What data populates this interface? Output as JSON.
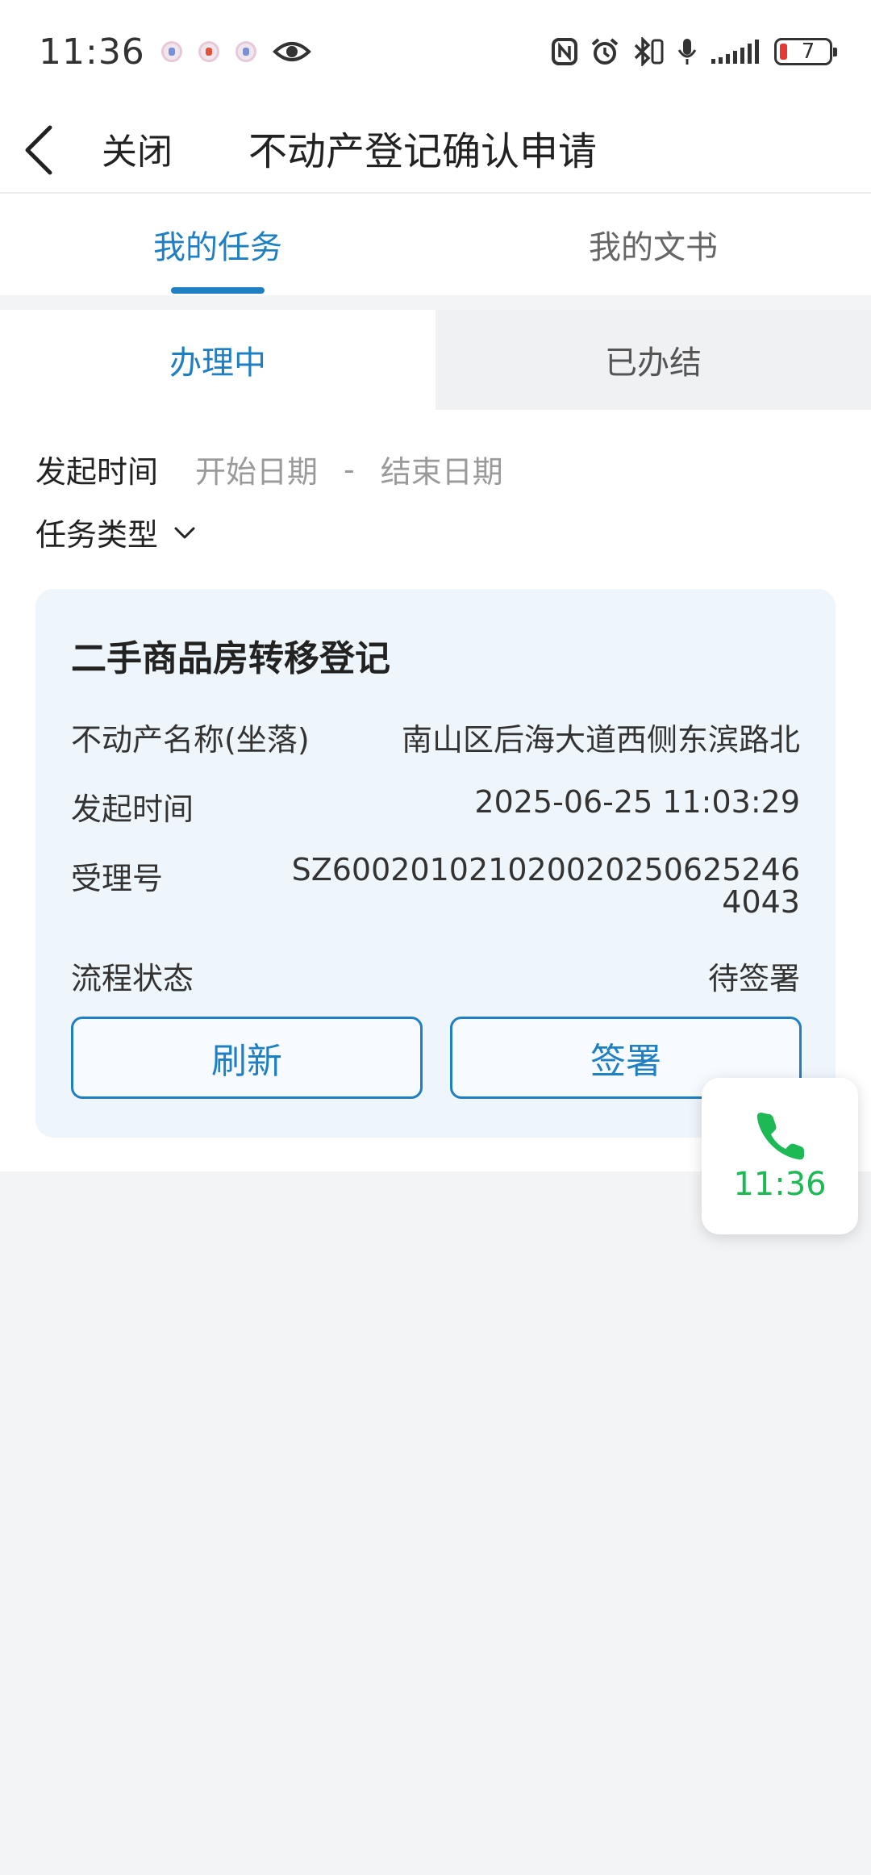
{
  "status_bar": {
    "time": "11:36",
    "battery_level": "7",
    "icons": [
      "nfc-icon",
      "alarm-icon",
      "bluetooth-icon",
      "microphone-icon",
      "signal-icon",
      "battery-icon"
    ]
  },
  "nav": {
    "back_icon": "chevron-left-icon",
    "close_label": "关闭",
    "title": "不动产登记确认申请"
  },
  "main_tabs": [
    {
      "label": "我的任务",
      "active": true
    },
    {
      "label": "我的文书",
      "active": false
    }
  ],
  "sub_tabs": [
    {
      "label": "办理中",
      "active": true
    },
    {
      "label": "已办结",
      "active": false
    }
  ],
  "filters": {
    "start_time_label": "发起时间",
    "start_placeholder": "开始日期",
    "separator": "-",
    "end_placeholder": "结束日期",
    "task_type_label": "任务类型"
  },
  "task_card": {
    "title": "二手商品房转移登记",
    "property_name_label": "不动产名称(坐落)",
    "property_name_value": "南山区后海大道西侧东滨路北",
    "start_time_label": "发起时间",
    "start_time_value": "2025-06-25 11:03:29",
    "accept_no_label": "受理号",
    "accept_no_value": "SZ6002010210200202506252464043",
    "status_label": "流程状态",
    "status_value": "待签署",
    "refresh_label": "刷新",
    "sign_label": "签署"
  },
  "call_widget": {
    "icon": "phone-icon",
    "time": "11:36"
  },
  "colors": {
    "accent": "#1e7fc2",
    "card_bg": "#eef5fb",
    "call_green": "#1db954",
    "battery_low": "#e53935"
  }
}
